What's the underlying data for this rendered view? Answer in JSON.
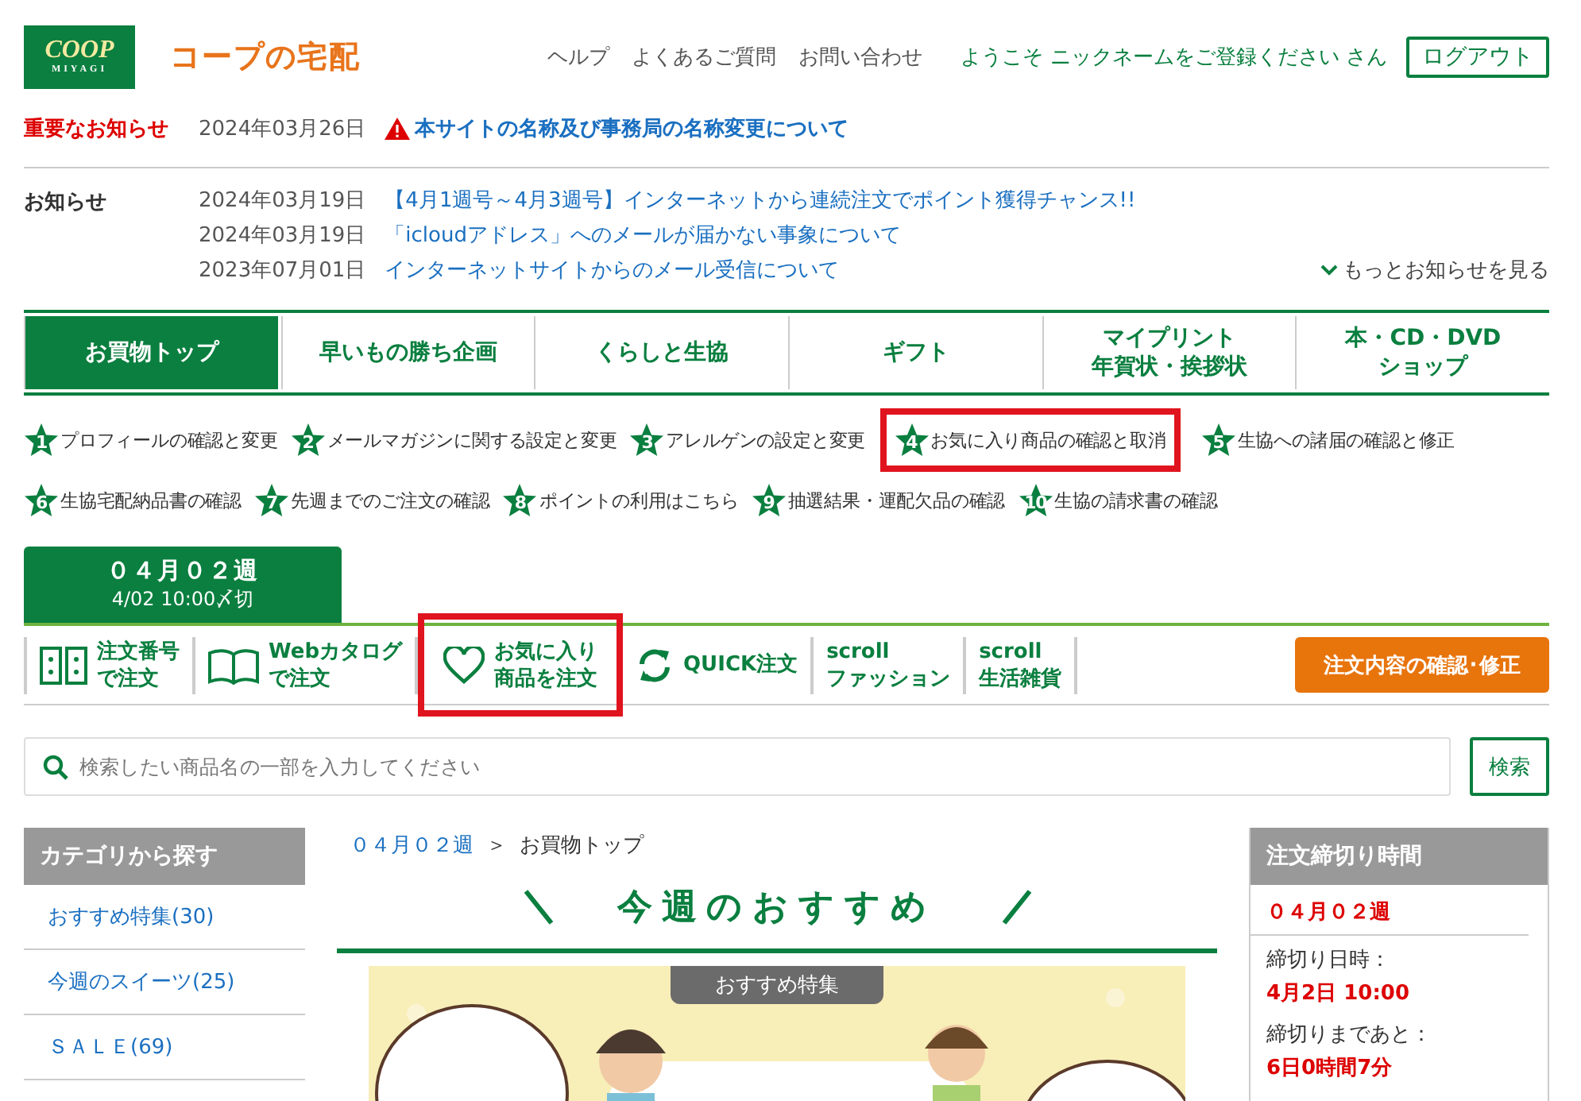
{
  "header": {
    "logo": "COOP",
    "logo_sub": "MIYAGI",
    "site_title": "コープの宅配",
    "links": [
      "ヘルプ",
      "よくあるご質問",
      "お問い合わせ"
    ],
    "welcome": "ようこそ ニックネームをご登録ください さん",
    "logout": "ログアウト"
  },
  "important_notice": {
    "label": "重要なお知らせ",
    "date": "2024年03月26日",
    "title": "本サイトの名称及び事務局の名称変更について"
  },
  "notices": {
    "label": "お知らせ",
    "items": [
      {
        "date": "2024年03月19日",
        "title": "【4月1週号～4月3週号】インターネットから連続注文でポイント獲得チャンス!!"
      },
      {
        "date": "2024年03月19日",
        "title": "「icloudアドレス」へのメールが届かない事象について"
      },
      {
        "date": "2023年07月01日",
        "title": "インターネットサイトからのメール受信について"
      }
    ],
    "more": "もっとお知らせを見る"
  },
  "main_nav": [
    {
      "lines": [
        "お買物トップ"
      ],
      "selected": true
    },
    {
      "lines": [
        "早いもの勝ち企画"
      ],
      "selected": false
    },
    {
      "lines": [
        "くらしと生協"
      ],
      "selected": false
    },
    {
      "lines": [
        "ギフト"
      ],
      "selected": false
    },
    {
      "lines": [
        "マイプリント",
        "年賀状・挨拶状"
      ],
      "selected": false
    },
    {
      "lines": [
        "本・CD・DVD",
        "ショップ"
      ],
      "selected": false
    }
  ],
  "quick_links": [
    {
      "number": "1",
      "label": "プロフィールの確認と変更",
      "highlighted": false
    },
    {
      "number": "2",
      "label": "メールマガジンに関する設定と変更",
      "highlighted": false
    },
    {
      "number": "3",
      "label": "アレルゲンの設定と変更",
      "highlighted": false
    },
    {
      "number": "4",
      "label": "お気に入り商品の確認と取消",
      "highlighted": true
    },
    {
      "number": "5",
      "label": "生協への諸届の確認と修正",
      "highlighted": false
    },
    {
      "number": "6",
      "label": "生協宅配納品書の確認",
      "highlighted": false
    },
    {
      "number": "7",
      "label": "先週までのご注文の確認",
      "highlighted": false
    },
    {
      "number": "8",
      "label": "ポイントの利用はこちら",
      "highlighted": false
    },
    {
      "number": "9",
      "label": "抽選結果・運配欠品の確認",
      "highlighted": false
    },
    {
      "number": "10",
      "label": "生協の請求書の確認",
      "highlighted": false
    }
  ],
  "week_tab": {
    "title": "０４月０２週",
    "deadline": "4/02 10:00〆切"
  },
  "order_tools": [
    {
      "kind": "number",
      "lines": [
        "注文番号",
        "で注文"
      ],
      "highlighted": false
    },
    {
      "kind": "catalog",
      "lines": [
        "Webカタログ",
        "で注文"
      ],
      "highlighted": false
    },
    {
      "kind": "favorite",
      "lines": [
        "お気に入り",
        "商品を注文"
      ],
      "highlighted": true
    },
    {
      "kind": "quick",
      "lines": [
        "QUICK注文"
      ],
      "highlighted": false
    },
    {
      "kind": "scroll",
      "lines": [
        "scroll",
        "ファッション"
      ],
      "highlighted": false
    },
    {
      "kind": "scroll",
      "lines": [
        "scroll",
        "生活雑貨"
      ],
      "highlighted": false
    }
  ],
  "order_button": "注文内容の確認･修正",
  "search": {
    "placeholder": "検索したい商品名の一部を入力してください",
    "button": "検索"
  },
  "sidebar": {
    "heading": "カテゴリから探す",
    "items": [
      "おすすめ特集(30)",
      "今週のスイーツ(25)",
      "ＳＡＬＥ(69)"
    ]
  },
  "breadcrumb": [
    "０４月０２週",
    "＞",
    "お買物トップ"
  ],
  "section_title": "今週のおすすめ",
  "banner": {
    "kind": "picture",
    "tag": "おすすめ特集"
  },
  "deadline_panel": {
    "heading": "注文締切り時間",
    "week": "０４月０２週",
    "rows": [
      {
        "label": "締切り日時：",
        "value": "4月2日 10:00"
      },
      {
        "label": "締切りまであと：",
        "value": "6日0時間7分"
      }
    ]
  }
}
